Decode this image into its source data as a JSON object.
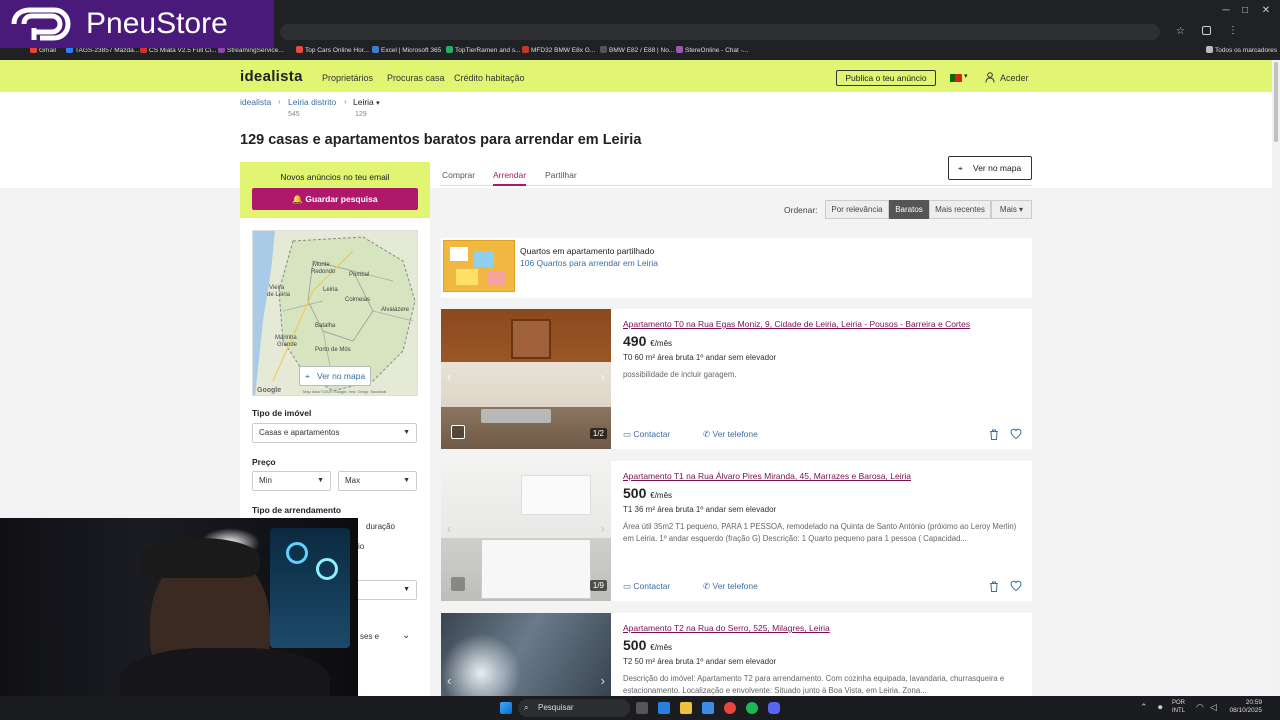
{
  "overlay_logo": {
    "text": "PneuStore"
  },
  "bookmarks": [
    {
      "label": "Gmail",
      "color": "#ea4335"
    },
    {
      "label": "TAGS-23857 Mazda...",
      "color": "#2d7ff9"
    },
    {
      "label": "CS Miata V2.5 Full Ci...",
      "color": "#d93025"
    },
    {
      "label": "StreamingService...",
      "color": "#8e44ad"
    },
    {
      "label": "Top Cars Online Hor...",
      "color": "#e74c3c"
    },
    {
      "label": "Excel | Microsoft 365",
      "color": "#3f7ecf"
    },
    {
      "label": "TopTierRamen and s...",
      "color": "#27ae60"
    },
    {
      "label": "MFD32 BMW E8x G...",
      "color": "#c0392b"
    },
    {
      "label": "BMW E82 / E88 | No...",
      "color": "#555555"
    },
    {
      "label": "StereOnline - Chat -...",
      "color": "#9b59b6"
    }
  ],
  "bookmarks_folder": "Todos os marcadores",
  "site": {
    "logo": "idealista",
    "nav": [
      "Proprietários",
      "Procuras casa",
      "Crédito habitação"
    ],
    "publish_button": "Publica o teu anúncio",
    "login": "Aceder",
    "accent": "#e1f573",
    "brand": "#b0196b"
  },
  "breadcrumb": [
    {
      "label": "idealista",
      "count": ""
    },
    {
      "label": "Leiria distrito",
      "count": "545"
    },
    {
      "label": "Leiria",
      "count": "129"
    }
  ],
  "page_title": "129 casas e apartamentos baratos para arrendar em Leiria",
  "sidebar": {
    "alert_text": "Novos anúncios no teu email",
    "save_button": "Guardar pesquisa",
    "map_button": "Ver no mapa",
    "map_labels": [
      "Monte Redondo",
      "Vieira de Leiria",
      "Leiria",
      "Marinha Grande",
      "Batalha",
      "Pombal",
      "Porto de Mós",
      "Caranguejeira",
      "Colmeias",
      "Alvaiázere"
    ],
    "map_credit": "Map data ©2025 Google, Inst. Geogr. Nacional",
    "property_type_label": "Tipo de imóvel",
    "property_type_value": "Casas e apartamentos",
    "price_label": "Preço",
    "price_min": "Min",
    "price_max": "Max",
    "rent_type_label": "Tipo de arrendamento",
    "rent_type_partial_1": "duração",
    "rent_type_partial_2": "io",
    "rent_type_partial_3": "ses e"
  },
  "tabs": [
    "Comprar",
    "Arrendar",
    "Partilhar"
  ],
  "map_view_button": "Ver no mapa",
  "sort": {
    "label": "Ordenar:",
    "options": [
      "Por relevância",
      "Baratos",
      "Mais recentes",
      "Mais"
    ]
  },
  "rooms_banner": {
    "title": "Quartos em apartamento partilhado",
    "link": "106 Quartos para arrendar em Leiria"
  },
  "listings": [
    {
      "title": "Apartamento T0 na Rua Egas Moniz, 9, Cidade de Leiria, Leiria - Pousos - Barreira e Cortes",
      "price": "490",
      "unit": "€/mês",
      "specs": "T0   60 m² área bruta   1º andar sem elevador",
      "desc": "possibilidade de incluir garagem.",
      "counter": "1/2",
      "contact": "Contactar",
      "phone": "Ver telefone"
    },
    {
      "title": "Apartamento T1 na Rua Álvaro Pires Miranda, 45, Marrazes e Barosa, Leiria",
      "price": "500",
      "unit": "€/mês",
      "specs": "T1   36 m² área bruta   1º andar sem elevador",
      "desc": "Área útil 35m2 T1 pequeno, PARA 1 PESSOA, remodelado na Quinta de Santo António (próximo ao Leroy Merlin) em Leiria. 1º andar esquerdo (fração G) Descrição: 1 Quarto pequeno para 1 pessoa ( Capacidad...",
      "counter": "1/9",
      "contact": "Contactar",
      "phone": "Ver telefone"
    },
    {
      "title": "Apartamento T2 na Rua do Serro, 525, Milagres, Leiria",
      "price": "500",
      "unit": "€/mês",
      "specs": "T2   50 m² área bruta   1º andar sem elevador",
      "desc": "Descrição do imóvel: Apartamento T2 para arrendamento. Com cozinha equipada, lavandaria, churrasqueira e estacionamento. Localização e envolvente: Situado junto à Boa Vista, em Leiria. Zona...",
      "counter": "",
      "contact": "Contactar",
      "phone": "Ver telefone"
    }
  ],
  "taskbar": {
    "search": "Pesquisar",
    "lang_1": "POR",
    "lang_2": "INTL",
    "time": "20:59",
    "date": "08/10/2025"
  }
}
